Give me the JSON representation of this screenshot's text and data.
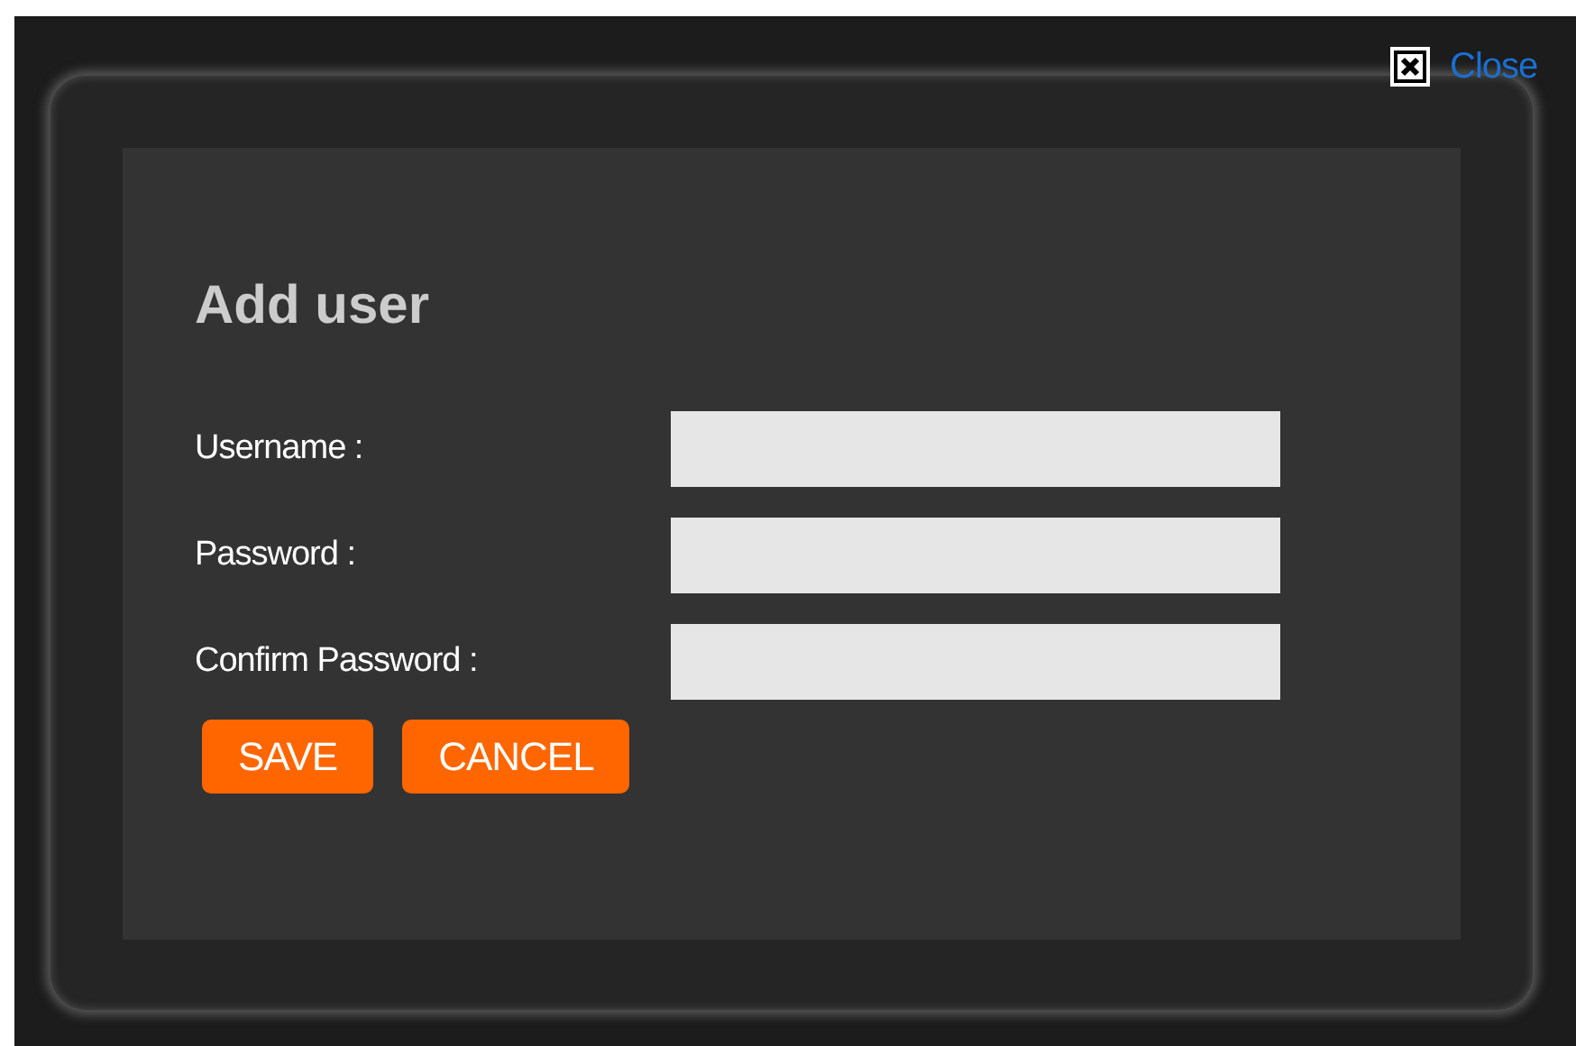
{
  "close": {
    "label": "Close"
  },
  "dialog": {
    "title": "Add user",
    "fields": [
      {
        "label": "Username :"
      },
      {
        "label": "Password :"
      },
      {
        "label": "Confirm Password :"
      }
    ],
    "buttons": [
      "SAVE",
      "CANCEL"
    ]
  }
}
